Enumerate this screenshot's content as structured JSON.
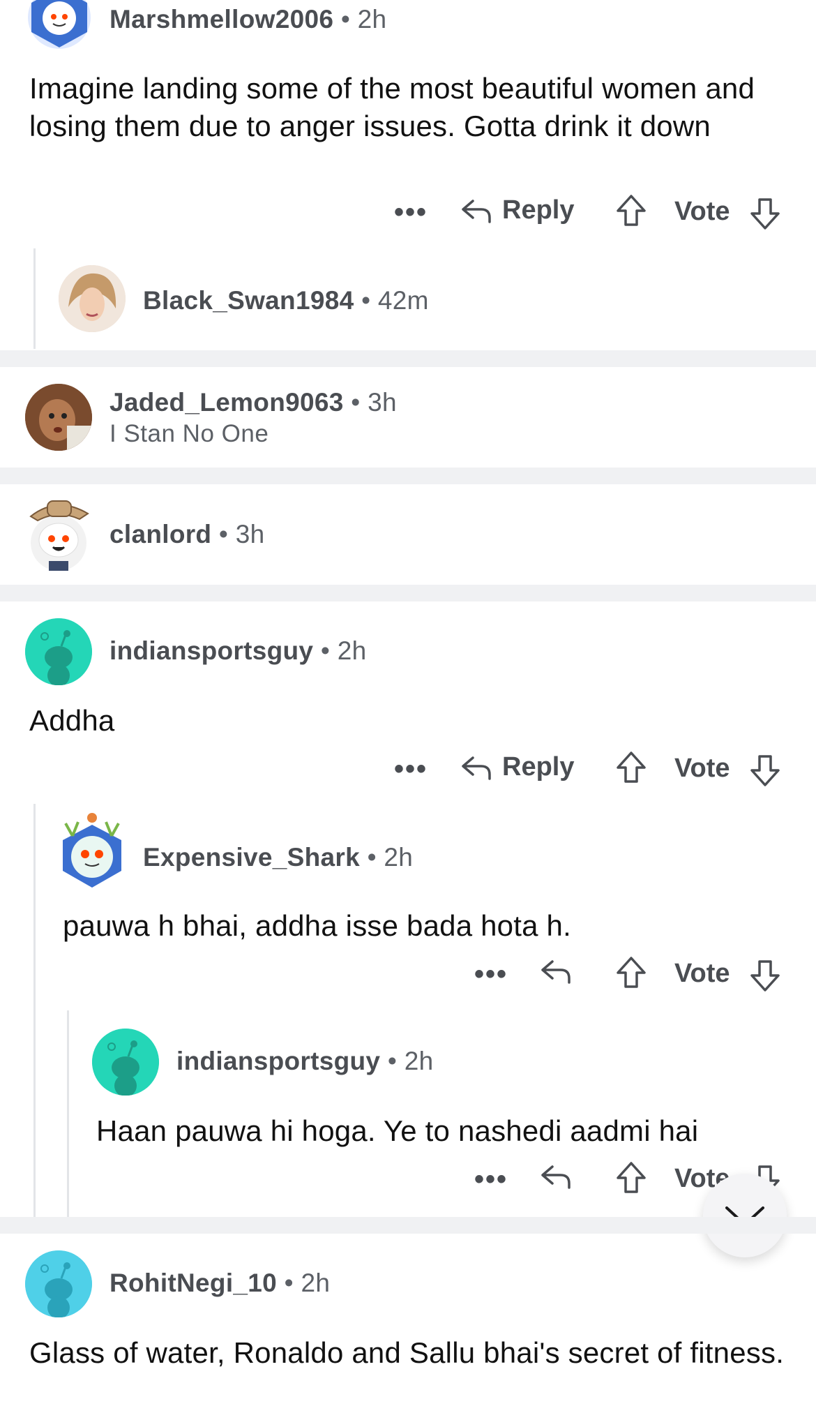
{
  "comments": [
    {
      "user": "Marshmellow2006",
      "time": "2h",
      "body": "Imagine landing some of the most beautiful women and losing them due to anger issues. Gotta drink it down"
    },
    {
      "user": "Black_Swan1984",
      "time": "42m"
    },
    {
      "user": "Jaded_Lemon9063",
      "time": "3h",
      "flair": "I Stan No One"
    },
    {
      "user": "clanlord",
      "time": "3h"
    },
    {
      "user": "indiansportsguy",
      "time": "2h",
      "body": "Addha"
    },
    {
      "user": "Expensive_Shark",
      "time": "2h",
      "body": "pauwa h bhai, addha isse bada hota h."
    },
    {
      "user": "indiansportsguy",
      "time": "2h",
      "body": "Haan pauwa hi hoga. Ye to nashedi aadmi hai"
    },
    {
      "user": "RohitNegi_10",
      "time": "2h",
      "body": "Glass of water, Ronaldo and Sallu bhai's secret of fitness."
    }
  ],
  "actions": {
    "reply": "Reply",
    "vote": "Vote",
    "more": "•••",
    "vote_cut": "Vote"
  },
  "meta_sep": "•",
  "colors": {
    "accent_teal": "#24d6b7",
    "separator": "#f0f1f3",
    "text_muted": "#5c6066"
  },
  "icons": [
    "reply-arrow-icon",
    "upvote-arrow-icon",
    "downvote-arrow-icon",
    "more-dots-icon",
    "chevron-down-icon",
    "snoo-avatar-icon"
  ]
}
